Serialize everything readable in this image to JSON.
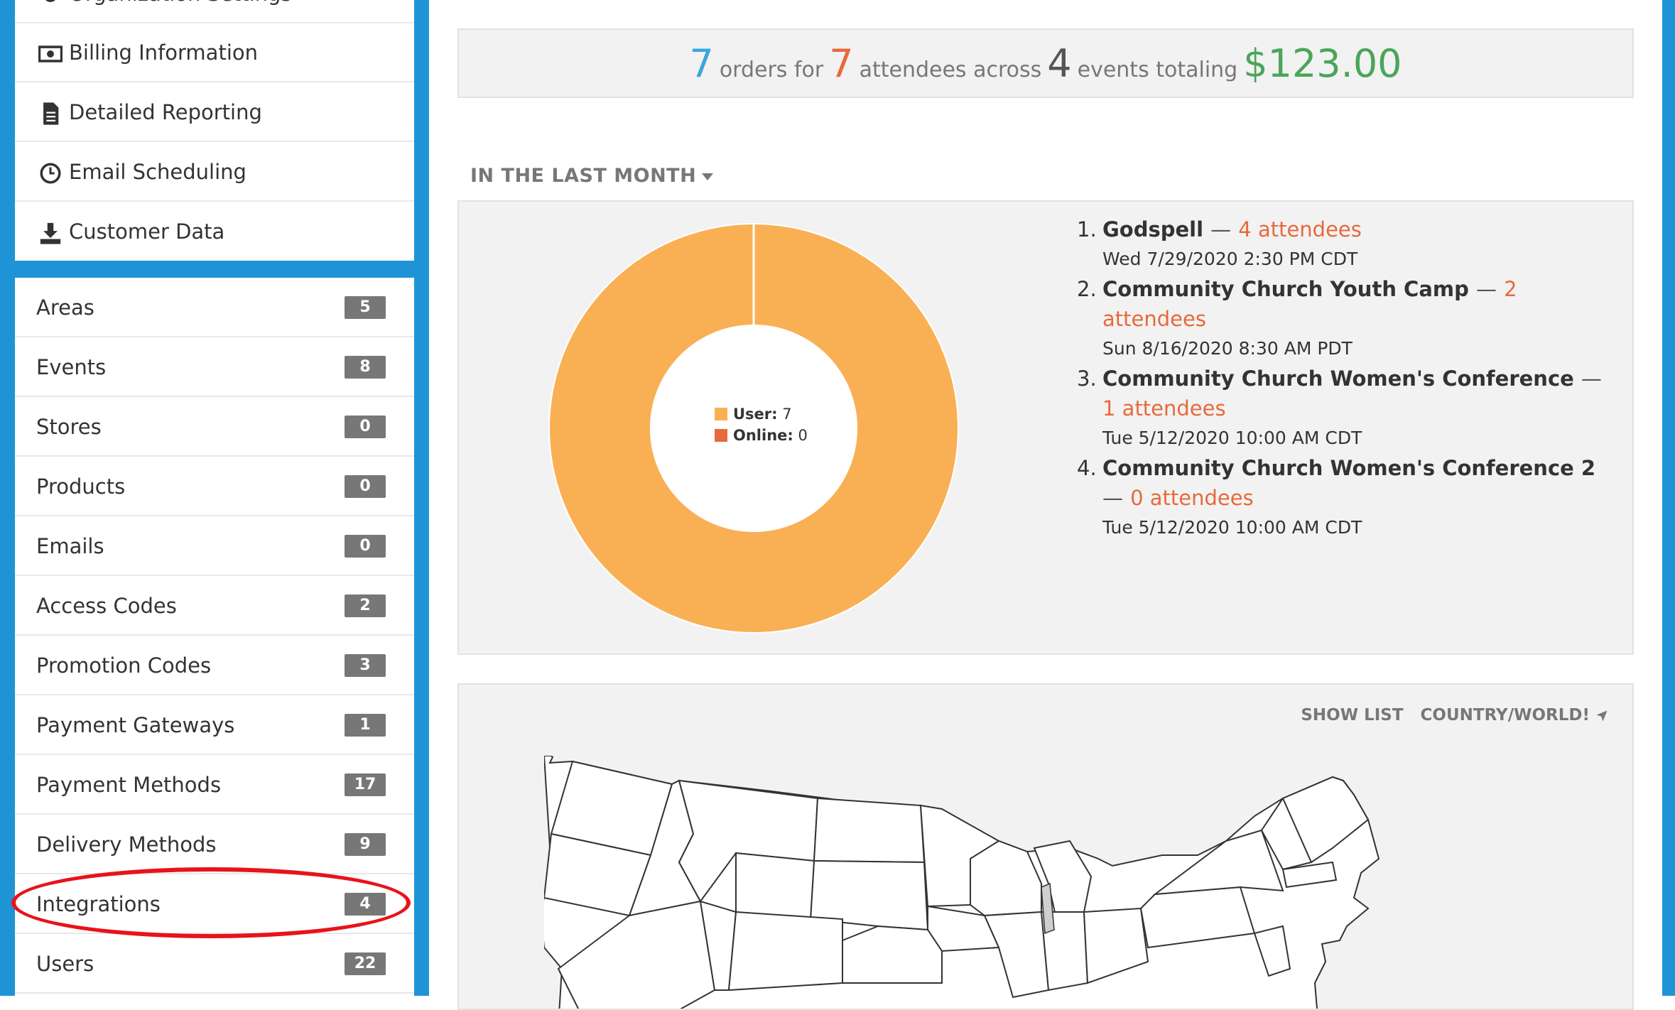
{
  "sidebar": {
    "top_menu": [
      {
        "label": "Organization Settings",
        "icon": "gear-icon"
      },
      {
        "label": "Billing Information",
        "icon": "money-icon"
      },
      {
        "label": "Detailed Reporting",
        "icon": "document-icon"
      },
      {
        "label": "Email Scheduling",
        "icon": "clock-icon"
      },
      {
        "label": "Customer Data",
        "icon": "download-icon"
      }
    ],
    "nav": [
      {
        "label": "Areas",
        "count": "5"
      },
      {
        "label": "Events",
        "count": "8"
      },
      {
        "label": "Stores",
        "count": "0"
      },
      {
        "label": "Products",
        "count": "0"
      },
      {
        "label": "Emails",
        "count": "0"
      },
      {
        "label": "Access Codes",
        "count": "2"
      },
      {
        "label": "Promotion Codes",
        "count": "3"
      },
      {
        "label": "Payment Gateways",
        "count": "1"
      },
      {
        "label": "Payment Methods",
        "count": "17"
      },
      {
        "label": "Delivery Methods",
        "count": "9"
      },
      {
        "label": "Integrations",
        "count": "4"
      },
      {
        "label": "Users",
        "count": "22"
      }
    ]
  },
  "summary": {
    "orders_count": "7",
    "orders_text": "orders for",
    "attendees_count": "7",
    "attendees_text": "attendees across",
    "events_count": "4",
    "events_text": "events totaling",
    "total": "$123.00"
  },
  "period": {
    "label": "IN THE LAST MONTH"
  },
  "chart_data": {
    "type": "pie",
    "categories": [
      "User",
      "Online"
    ],
    "values": [
      7,
      0
    ],
    "colors": [
      "#f9b055",
      "#e8693b"
    ],
    "legend_labels": [
      "User:",
      "Online:"
    ],
    "legend_values": [
      "7",
      "0"
    ]
  },
  "events": [
    {
      "idx": "1.",
      "name": "Godspell",
      "attendees": "4 attendees",
      "date": "Wed 7/29/2020 2:30 PM CDT"
    },
    {
      "idx": "2.",
      "name": "Community Church Youth Camp",
      "attendees": "2 attendees",
      "date": "Sun 8/16/2020 8:30 AM PDT"
    },
    {
      "idx": "3.",
      "name": "Community Church Women's Conference",
      "attendees": "1 attendees",
      "date": "Tue 5/12/2020 10:00 AM CDT"
    },
    {
      "idx": "4.",
      "name": "Community Church Women's Conference 2",
      "attendees": "0 attendees",
      "date": "Tue 5/12/2020 10:00 AM CDT"
    }
  ],
  "map": {
    "show_list": "SHOW LIST",
    "toggle": "COUNTRY/WORLD!"
  },
  "colors": {
    "sidebar_bg": "#1e94d6",
    "badge_bg": "#777777",
    "highlight": "#e8131b"
  }
}
